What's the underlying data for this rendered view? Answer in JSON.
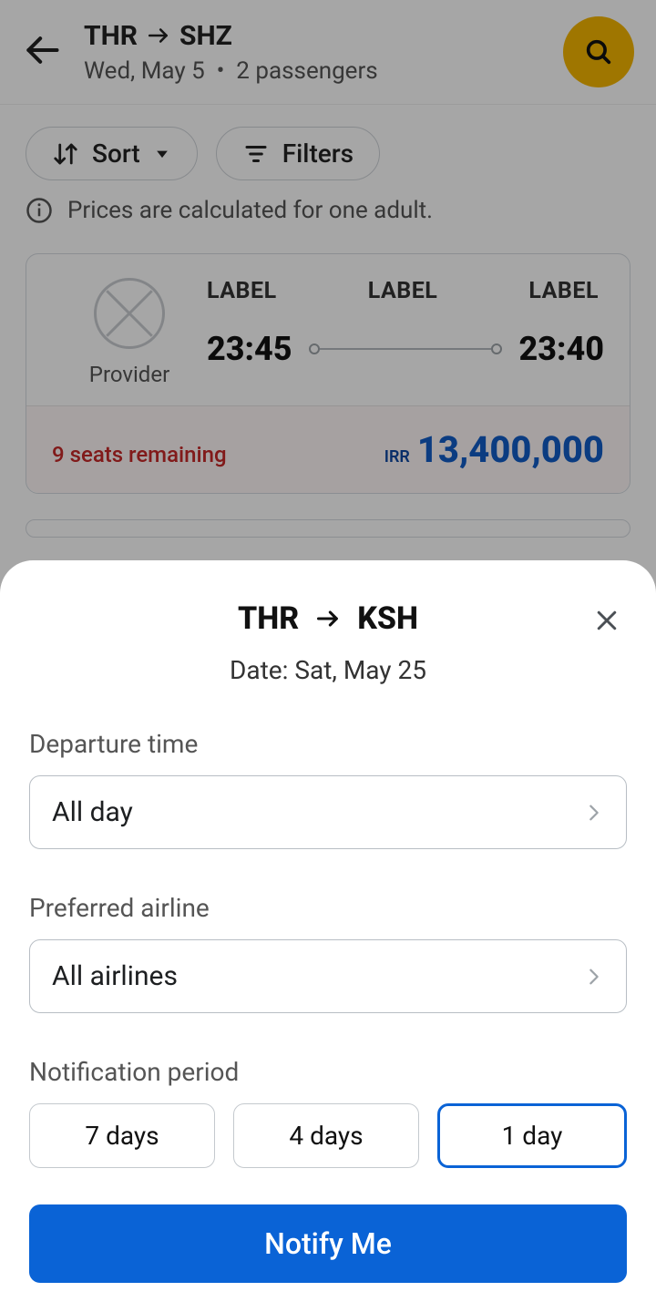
{
  "header": {
    "origin": "THR",
    "destination": "SHZ",
    "date": "Wed, May 5",
    "passengers": "2 passengers"
  },
  "chips": {
    "sort_label": "Sort",
    "filters_label": "Filters"
  },
  "info_text": "Prices are calculated for one adult.",
  "flight_card": {
    "provider_label": "Provider",
    "tag1": "LABEL",
    "tag2": "LABEL",
    "tag3": "LABEL",
    "depart_time": "23:45",
    "arrive_time": "23:40",
    "seats_text": "9 seats remaining",
    "currency": "IRR",
    "price": "13,400,000"
  },
  "sheet": {
    "origin": "THR",
    "destination": "KSH",
    "date_label": "Date: Sat, May 25",
    "dep_time_label": "Departure time",
    "dep_time_value": "All day",
    "airline_label": "Preferred airline",
    "airline_value": "All airlines",
    "period_label": "Notification period",
    "period_options": [
      "7 days",
      "4 days",
      "1 day"
    ],
    "period_selected_index": 2,
    "cta": "Notify Me"
  }
}
